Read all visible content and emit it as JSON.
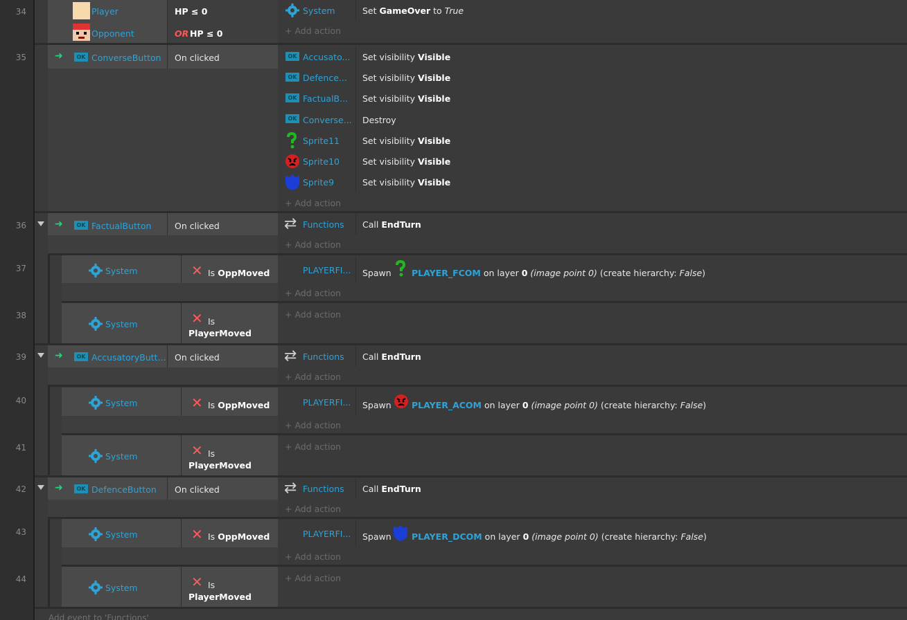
{
  "line_numbers": [
    "34",
    "35",
    "36",
    "37",
    "38",
    "39",
    "40",
    "41",
    "42",
    "43",
    "44"
  ],
  "add_action_label": "Add action",
  "labels": {
    "on_clicked": "On clicked",
    "is": "Is",
    "set_visibility": "Set visibility",
    "visible": "Visible",
    "destroy": "Destroy",
    "call": "Call",
    "spawn": "Spawn",
    "on_layer": "on layer",
    "layer_value": "0",
    "image_point": "(image point 0)",
    "create_hierarchy": "(create hierarchy:",
    "false_value": "False",
    "close_paren": ")"
  },
  "objects": {
    "player": "Player",
    "opponent": "Opponent",
    "system": "System",
    "functions": "Functions",
    "converse_button": "ConverseButton",
    "factual_button": "FactualButton",
    "accusatory_button": "AccusatoryButt...",
    "defence_button": "DefenceButton",
    "accusato": "Accusato...",
    "defence": "Defence...",
    "factualb": "FactualB...",
    "converse": "Converse...",
    "sprite11": "Sprite11",
    "sprite10": "Sprite10",
    "sprite9": "Sprite9",
    "playerfi": "PLAYERFI..."
  },
  "event34": {
    "cond1_prefix": "HP ≤ 0",
    "cond2_or": "OR",
    "cond2_text": "HP ≤ 0",
    "action_set": "Set",
    "action_var": "GameOver",
    "action_to": "to",
    "action_value": "True"
  },
  "call_target": "EndTurn",
  "opp_moved": "OppMoved",
  "player_moved": "PlayerMoved",
  "spawns": {
    "fcom": "PLAYER_FCOM",
    "acom": "PLAYER_ACOM",
    "dcom": "PLAYER_DCOM"
  },
  "footer_note": "Add event to 'Functions'",
  "colors": {
    "object_link": "#2ea3d6",
    "or_keyword": "#ff5555",
    "trigger_arrow": "#27d27a",
    "invert_x": "#ff5a5a",
    "background": "#3a3a3a"
  }
}
